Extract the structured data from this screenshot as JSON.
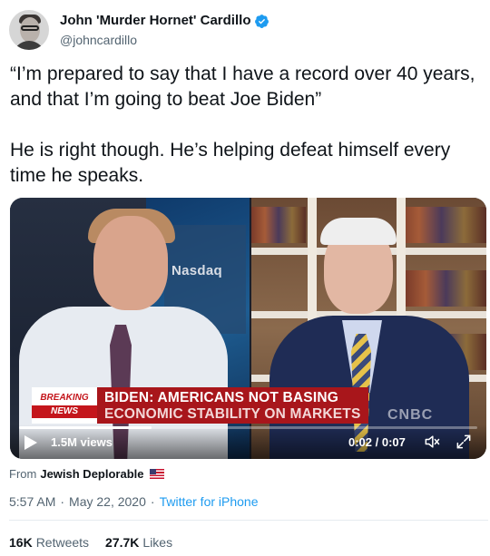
{
  "author": {
    "display_name": "John 'Murder Hornet' Cardillo",
    "handle": "@johncardillo",
    "verified": true,
    "verified_color": "#1d9bf0"
  },
  "tweet": {
    "paragraph_1": "“I’m prepared to say that I have a record over 40 years, and that I’m going to beat Joe Biden”",
    "paragraph_2": "He is right though. He’s helping defeat himself every time he speaks."
  },
  "video": {
    "background_sign": "Nasdaq",
    "breaking_line1": "BREAKING",
    "breaking_line2": "NEWS",
    "headline_line1": "BIDEN: AMERICANS NOT BASING",
    "headline_line2": "ECONOMIC STABILITY ON MARKETS",
    "network_logo": "CNBC",
    "views": "1.5M views",
    "time": "0:02 / 0:07",
    "progress_fraction": 0.29,
    "chyron_color": "#a8161b"
  },
  "source": {
    "prefix": "From",
    "name": "Jewish Deplorable"
  },
  "meta": {
    "time": "5:57 AM",
    "date": "May 22, 2020",
    "client": "Twitter for iPhone",
    "separator": "·"
  },
  "stats": {
    "retweets_count": "16K",
    "retweets_label": "Retweets",
    "likes_count": "27.7K",
    "likes_label": "Likes"
  }
}
